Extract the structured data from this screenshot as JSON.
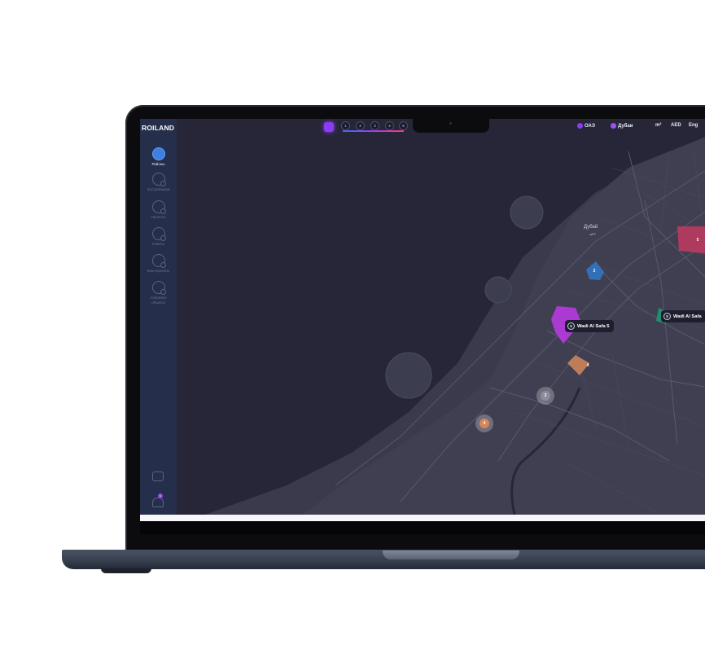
{
  "app": {
    "logo": "ROILAND"
  },
  "sidebar": {
    "items": [
      {
        "label": "Районы",
        "active": true,
        "icon": "district-icon"
      },
      {
        "label": "Застройщики",
        "active": false,
        "icon": "developer-icon"
      },
      {
        "label": "Проекты",
        "active": false,
        "icon": "projects-icon"
      },
      {
        "label": "Юниты",
        "active": false,
        "icon": "units-icon"
      },
      {
        "label": "Мои проекты",
        "active": false,
        "icon": "my-projects-icon"
      },
      {
        "label": "Аппрейзл объекта",
        "active": false,
        "icon": "appraisal-icon"
      }
    ],
    "notifications_badge": "1"
  },
  "topbar": {
    "steps": [
      "1",
      "2",
      "3",
      "4",
      "5"
    ],
    "country": "ОАЭ",
    "city": "Дубаи",
    "unit": "m²",
    "currency": "AED",
    "language": "Eng"
  },
  "map": {
    "city_label": "Дубай",
    "city_label_ar": "دبي",
    "pins": [
      {
        "num": "5",
        "label": "Wadi Al Safa 5",
        "color": "#b83ae0"
      },
      {
        "num": "5",
        "label": "Wadi Al Safa",
        "color": "#1f9a72"
      }
    ],
    "markers": [
      "2",
      "4",
      "3",
      "4",
      "5"
    ]
  },
  "colors": {
    "screen_bg": "#262638",
    "sidebar_bg": "#252e4a",
    "accent": "#8a3cf3"
  }
}
